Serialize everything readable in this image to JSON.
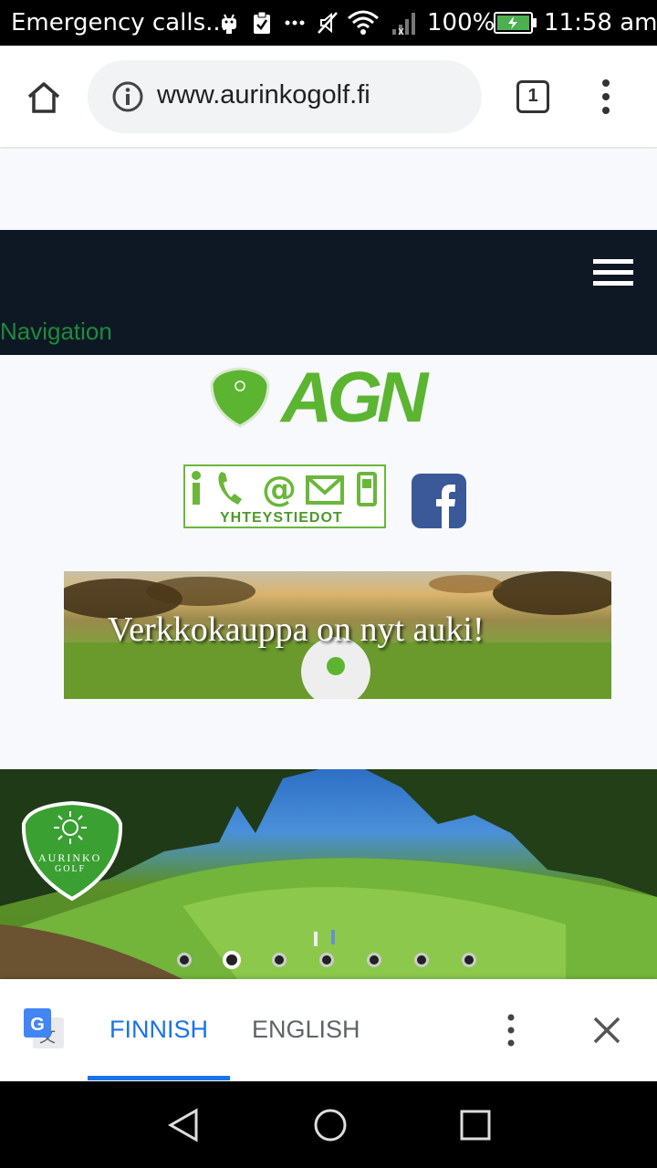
{
  "status_bar": {
    "notification_text": "Emergency calls...",
    "battery": "100%",
    "time": "11:58 am"
  },
  "browser": {
    "url": "www.aurinkogolf.fi",
    "tab_count": "1"
  },
  "page": {
    "nav_label": "Navigation",
    "logo_text": "AGN",
    "contact_label": "YHTEYSTIEDOT",
    "banner_text": "Verkkokauppa on nyt auki!",
    "hero_badge_line1": "AURINKO",
    "hero_badge_line2": "GOLF",
    "slider": {
      "count": 7,
      "active_index": 1
    }
  },
  "translate_bar": {
    "lang_active": "FINNISH",
    "lang_other": "ENGLISH"
  },
  "colors": {
    "brand_green": "#5cb531",
    "nav_dark": "#0e1824",
    "accent_blue": "#1a73e8",
    "facebook_blue": "#3b5998"
  }
}
